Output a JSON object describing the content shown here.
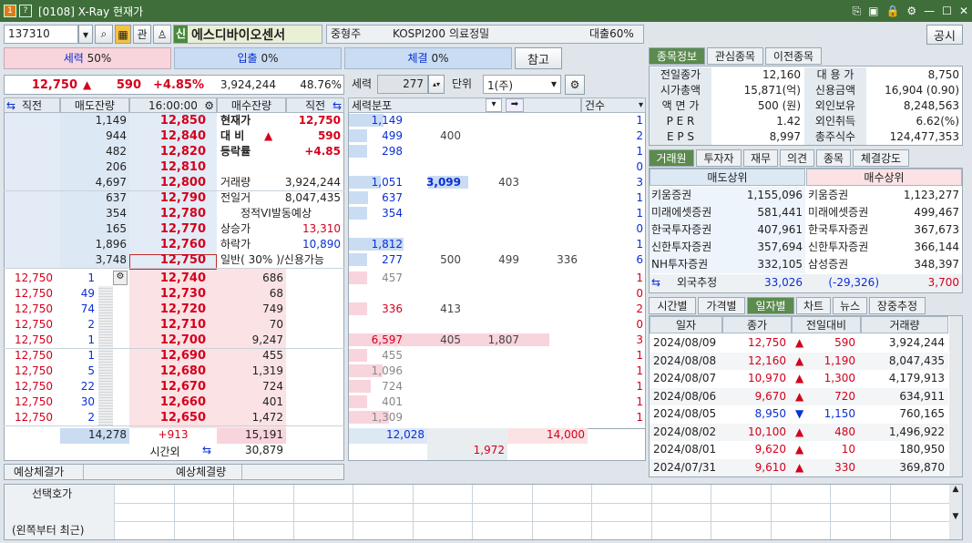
{
  "window": {
    "title": "[0108] X-Ray 현재가",
    "icons": [
      "1",
      "?"
    ]
  },
  "header": {
    "code": "137310",
    "stock_name": "에스디바이오센서",
    "market_badge": "신",
    "gwan": "관",
    "type": "중형주",
    "index": "KOSPI200",
    "sector": "의료정밀",
    "loan": "대출60%",
    "notice_btn": "공시",
    "reference_btn": "참고"
  },
  "power_bars": {
    "power_label": "세력",
    "power_val": "50%",
    "inflow_label": "입출",
    "inflow_val": "0%",
    "exec_label": "체결",
    "exec_val": "0%"
  },
  "price_line": {
    "price": "12,750",
    "change": "590",
    "rate": "+4.85%",
    "volume": "3,924,244",
    "ratio": "48.76%"
  },
  "power_ctrl": {
    "label": "세력",
    "value": "277",
    "unit_label": "단위",
    "unit_value": "1(주)"
  },
  "ob_header": {
    "c1": "직전",
    "c2": "매도잔량",
    "c3": "16:00:00",
    "c4": "매수잔량",
    "c5": "직전"
  },
  "asks": [
    {
      "qty": "1,149",
      "price": "12,850"
    },
    {
      "qty": "944",
      "price": "12,840"
    },
    {
      "qty": "482",
      "price": "12,820"
    },
    {
      "qty": "206",
      "price": "12,810"
    },
    {
      "qty": "4,697",
      "price": "12,800"
    },
    {
      "qty": "637",
      "price": "12,790"
    },
    {
      "qty": "354",
      "price": "12,780"
    },
    {
      "qty": "165",
      "price": "12,770"
    },
    {
      "qty": "1,896",
      "price": "12,760"
    },
    {
      "qty": "3,748",
      "price": "12,750"
    }
  ],
  "info": [
    {
      "k": "현재가",
      "v": "12,750"
    },
    {
      "k": "대  비",
      "v": "590"
    },
    {
      "k": "등락률",
      "v": "+4.85"
    },
    {
      "k": "",
      "v": ""
    },
    {
      "k": "거래량",
      "v": "3,924,244"
    },
    {
      "k": "전일거",
      "v": "8,047,435"
    },
    {
      "k": "정적VI발동예상",
      "v": ""
    },
    {
      "k": "상승가",
      "v": "13,310"
    },
    {
      "k": "하락가",
      "v": "10,890"
    },
    {
      "k": "일반( 30% )/신용가능",
      "v": ""
    }
  ],
  "bids": [
    {
      "prev": "12,750",
      "pq": "1",
      "price": "12,740",
      "qty": "686"
    },
    {
      "prev": "12,750",
      "pq": "49",
      "price": "12,730",
      "qty": "68"
    },
    {
      "prev": "12,750",
      "pq": "74",
      "price": "12,720",
      "qty": "749"
    },
    {
      "prev": "12,750",
      "pq": "2",
      "price": "12,710",
      "qty": "70"
    },
    {
      "prev": "12,750",
      "pq": "1",
      "price": "12,700",
      "qty": "9,247"
    },
    {
      "prev": "12,750",
      "pq": "1",
      "price": "12,690",
      "qty": "455"
    },
    {
      "prev": "12,750",
      "pq": "5",
      "price": "12,680",
      "qty": "1,319"
    },
    {
      "prev": "12,750",
      "pq": "22",
      "price": "12,670",
      "qty": "724"
    },
    {
      "prev": "12,750",
      "pq": "30",
      "price": "12,660",
      "qty": "401"
    },
    {
      "prev": "12,750",
      "pq": "2",
      "price": "12,650",
      "qty": "1,472"
    }
  ],
  "totals": {
    "ask_total": "14,278",
    "diff": "+913",
    "bid_total": "15,191",
    "after_label": "시간외",
    "after_val": "30,879"
  },
  "expect": {
    "price_label": "예상체결가",
    "qty_label": "예상체결량"
  },
  "dist_header": {
    "label": "세력분포",
    "count": "건수"
  },
  "dist_rows": [
    {
      "a": "1,149",
      "b": "",
      "c": "",
      "d": "",
      "n": "1"
    },
    {
      "a": "499",
      "b": "400",
      "c": "",
      "d": "",
      "n": "2"
    },
    {
      "a": "298",
      "b": "",
      "c": "",
      "d": "",
      "n": "1"
    },
    {
      "a": "",
      "b": "",
      "c": "",
      "d": "",
      "n": "0"
    },
    {
      "a": "1,051",
      "b": "3,099",
      "c": "403",
      "d": "",
      "n": "3"
    },
    {
      "a": "637",
      "b": "",
      "c": "",
      "d": "",
      "n": "1"
    },
    {
      "a": "354",
      "b": "",
      "c": "",
      "d": "",
      "n": "1"
    },
    {
      "a": "",
      "b": "",
      "c": "",
      "d": "",
      "n": "0"
    },
    {
      "a": "1,812",
      "b": "",
      "c": "",
      "d": "",
      "n": "1"
    },
    {
      "a": "277",
      "b": "500",
      "c": "499",
      "d": "336",
      "n": "6"
    },
    {
      "a": "457",
      "b": "",
      "c": "",
      "d": "",
      "n": "1"
    },
    {
      "a": "",
      "b": "",
      "c": "",
      "d": "",
      "n": "0"
    },
    {
      "a": "336",
      "b": "413",
      "c": "",
      "d": "",
      "n": "2"
    },
    {
      "a": "",
      "b": "",
      "c": "",
      "d": "",
      "n": "0"
    },
    {
      "a": "6,597",
      "b": "405",
      "c": "1,807",
      "d": "",
      "n": "3"
    },
    {
      "a": "455",
      "b": "",
      "c": "",
      "d": "",
      "n": "1"
    },
    {
      "a": "1,096",
      "b": "",
      "c": "",
      "d": "",
      "n": "1"
    },
    {
      "a": "724",
      "b": "",
      "c": "",
      "d": "",
      "n": "1"
    },
    {
      "a": "401",
      "b": "",
      "c": "",
      "d": "",
      "n": "1"
    },
    {
      "a": "1,309",
      "b": "",
      "c": "",
      "d": "",
      "n": "1"
    }
  ],
  "dist_totals": {
    "ask": "12,028",
    "bid": "14,000",
    "diff": "1,972"
  },
  "stock_tabs": [
    "종목정보",
    "관심종목",
    "이전종목"
  ],
  "stock_info": [
    {
      "k1": "전일종가",
      "v1": "12,160",
      "k2": "대 용 가",
      "v2": "8,750"
    },
    {
      "k1": "시가총액",
      "v1": "15,871(억)",
      "k2": "신용금액",
      "v2": "16,904  (0.90)"
    },
    {
      "k1": "액 면 가",
      "v1": "500 (원)",
      "k2": "외인보유",
      "v2": "8,248,563"
    },
    {
      "k1": "P E R",
      "v1": "1.42",
      "k2": "외인취득",
      "v2": "6.62(%)"
    },
    {
      "k1": "E P S",
      "v1": "8,997",
      "k2": "총주식수",
      "v2": "124,477,353"
    }
  ],
  "broker_tabs": [
    "거래원",
    "투자자",
    "재무",
    "의견",
    "종목",
    "체결강도"
  ],
  "broker_head": {
    "sell": "매도상위",
    "buy": "매수상위"
  },
  "brokers": [
    {
      "s": "키움증권",
      "sv": "1,155,096",
      "b": "키움증권",
      "bv": "1,123,277"
    },
    {
      "s": "미래에셋증권",
      "sv": "581,441",
      "b": "미래에셋증권",
      "bv": "499,467"
    },
    {
      "s": "한국투자증권",
      "sv": "407,961",
      "b": "한국투자증권",
      "bv": "367,673"
    },
    {
      "s": "신한투자증권",
      "sv": "357,694",
      "b": "신한투자증권",
      "bv": "366,144"
    },
    {
      "s": "NH투자증권",
      "sv": "332,105",
      "b": "삼성증권",
      "bv": "348,397"
    }
  ],
  "foreign": {
    "label": "외국추정",
    "sell": "33,026",
    "diff": "(-29,326)",
    "buy": "3,700"
  },
  "daily_tabs": [
    "시간별",
    "가격별",
    "일자별",
    "차트",
    "뉴스",
    "장중추정"
  ],
  "daily_head": {
    "date": "일자",
    "close": "종가",
    "change": "전일대비",
    "volume": "거래량"
  },
  "daily": [
    {
      "d": "2024/08/09",
      "c": "12,750",
      "dir": "▲",
      "ch": "590",
      "v": "3,924,244"
    },
    {
      "d": "2024/08/08",
      "c": "12,160",
      "dir": "▲",
      "ch": "1,190",
      "v": "8,047,435"
    },
    {
      "d": "2024/08/07",
      "c": "10,970",
      "dir": "▲",
      "ch": "1,300",
      "v": "4,179,913"
    },
    {
      "d": "2024/08/06",
      "c": "9,670",
      "dir": "▲",
      "ch": "720",
      "v": "634,911"
    },
    {
      "d": "2024/08/05",
      "c": "8,950",
      "dir": "▼",
      "ch": "1,150",
      "v": "760,165"
    },
    {
      "d": "2024/08/02",
      "c": "10,100",
      "dir": "▲",
      "ch": "480",
      "v": "1,496,922"
    },
    {
      "d": "2024/08/01",
      "c": "9,620",
      "dir": "▲",
      "ch": "10",
      "v": "180,950"
    },
    {
      "d": "2024/07/31",
      "c": "9,610",
      "dir": "▲",
      "ch": "330",
      "v": "369,870"
    }
  ],
  "bottom": {
    "label1": "선택호가",
    "label2": "(왼쪽부터 최근)"
  }
}
